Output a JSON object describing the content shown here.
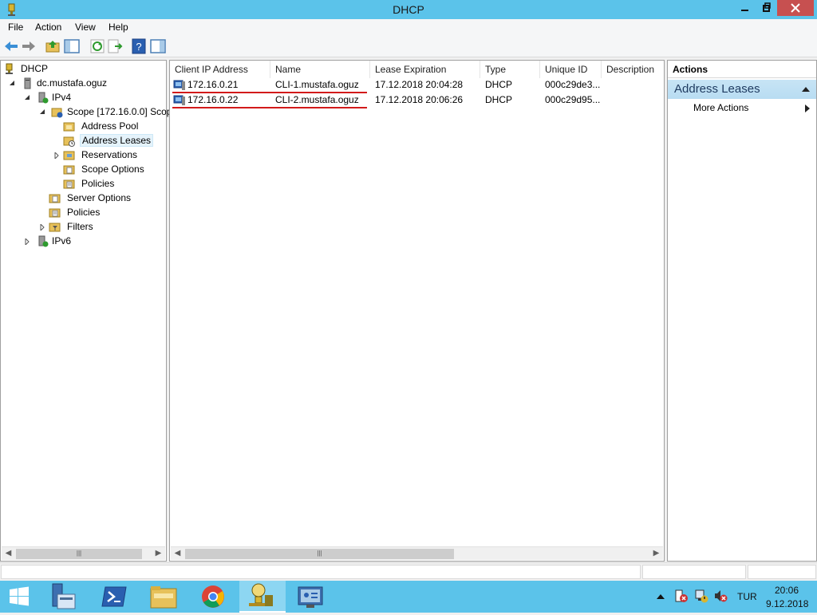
{
  "window": {
    "title": "DHCP"
  },
  "menu": {
    "file": "File",
    "action": "Action",
    "view": "View",
    "help": "Help"
  },
  "tree": {
    "root": "DHCP",
    "server": "dc.mustafa.oguz",
    "ipv4": "IPv4",
    "scope": "Scope [172.16.0.0] Scop",
    "address_pool": "Address Pool",
    "address_leases": "Address Leases",
    "reservations": "Reservations",
    "scope_options": "Scope Options",
    "scope_policies": "Policies",
    "server_options": "Server Options",
    "policies": "Policies",
    "filters": "Filters",
    "ipv6": "IPv6"
  },
  "list": {
    "columns": [
      "Client IP Address",
      "Name",
      "Lease Expiration",
      "Type",
      "Unique ID",
      "Description"
    ],
    "rows": [
      {
        "ip": "172.16.0.21",
        "name": "CLI-1.mustafa.oguz",
        "expiration": "17.12.2018 20:04:28",
        "type": "DHCP",
        "uid": "000c29de3...",
        "desc": ""
      },
      {
        "ip": "172.16.0.22",
        "name": "CLI-2.mustafa.oguz",
        "expiration": "17.12.2018 20:06:26",
        "type": "DHCP",
        "uid": "000c29d95...",
        "desc": ""
      }
    ],
    "annotation_color": "#d21a1a"
  },
  "actions": {
    "title": "Actions",
    "section": "Address Leases",
    "more_actions": "More Actions"
  },
  "taskbar": {
    "language": "TUR",
    "time": "20:06",
    "date": "9.12.2018"
  },
  "colors": {
    "titlebar": "#5bc3ea",
    "close_button": "#c75050",
    "selection": "#e5f3fb"
  }
}
